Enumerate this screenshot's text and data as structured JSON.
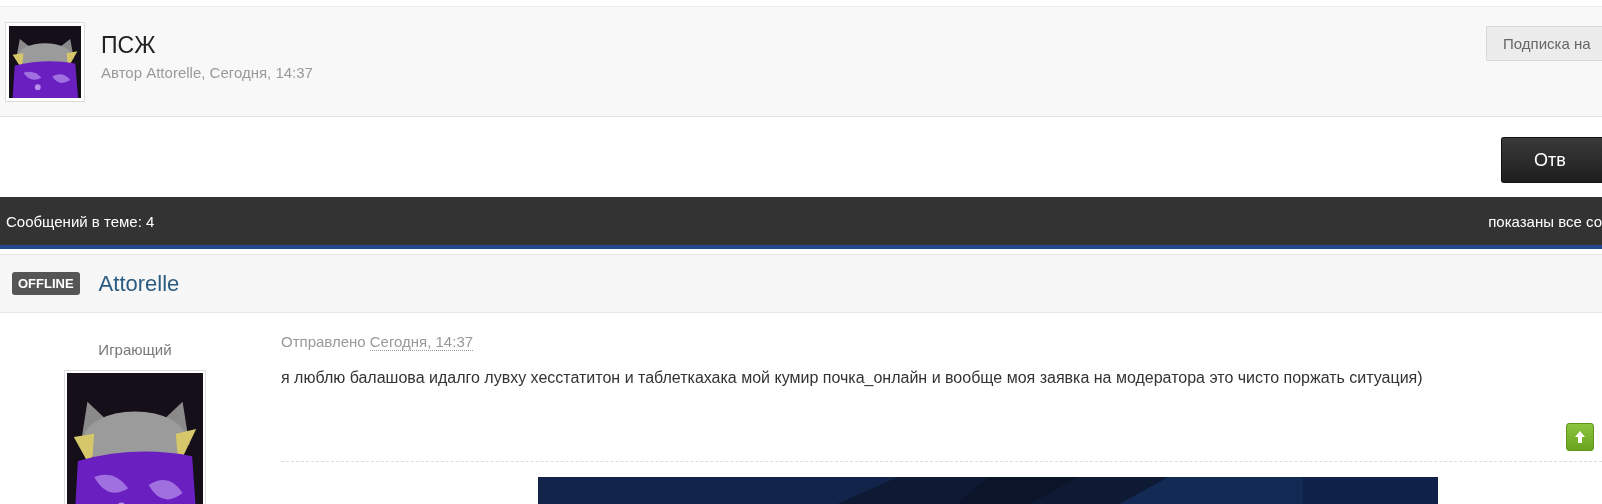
{
  "topic": {
    "title": "ПСЖ",
    "byline": "Автор Attorelle, Сегодня, 14:37",
    "subscribe_button": "Подписка на"
  },
  "reply_button": "Отв",
  "topic_bar": {
    "post_count": "Сообщений в теме: 4",
    "shown": "показаны все со"
  },
  "posts": [
    {
      "online": false,
      "status": "OFFLINE",
      "author": "Attorelle",
      "rank": "Играющий",
      "posted_label": "Отправлено",
      "posted_time": "Сегодня, 14:37",
      "body": "я люблю балашова идалго лувху хесстатитон и таблеткахака мой кумир почка_онлайн и вообще моя заявка на модератора это чисто поржать ситуация)"
    }
  ]
}
